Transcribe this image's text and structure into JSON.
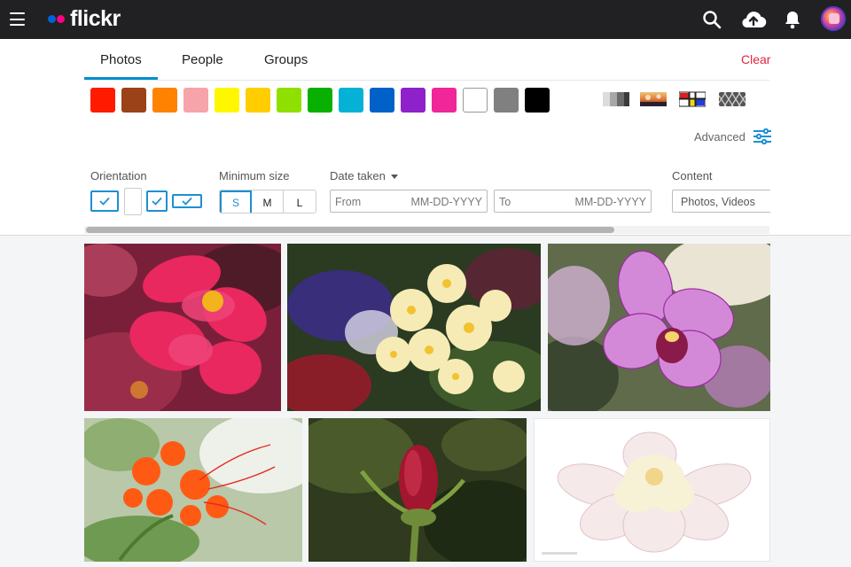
{
  "app": {
    "name": "flickr"
  },
  "tabs": [
    {
      "label": "Photos",
      "active": true
    },
    {
      "label": "People",
      "active": false
    },
    {
      "label": "Groups",
      "active": false
    }
  ],
  "clear_label": "Clear",
  "colors": [
    "#ff1a00",
    "#9c4218",
    "#ff8200",
    "#f7a3aa",
    "#fff700",
    "#ffcd00",
    "#8fe000",
    "#09b000",
    "#05b2d6",
    "#0062c9",
    "#8e21c9",
    "#f02799",
    "#ffffff",
    "#808080",
    "#000000"
  ],
  "style_filters": [
    "black-and-white-icon",
    "shallow-depth-of-field-icon",
    "minimalist-icon",
    "pattern-icon"
  ],
  "advanced_label": "Advanced",
  "filters": {
    "orientation": {
      "label": "Orientation",
      "options": [
        {
          "name": "landscape",
          "checked": true
        },
        {
          "name": "portrait",
          "checked": false
        },
        {
          "name": "square",
          "checked": true
        },
        {
          "name": "panorama",
          "checked": true
        }
      ]
    },
    "min_size": {
      "label": "Minimum size",
      "options": [
        "S",
        "M",
        "L"
      ],
      "selected": "S"
    },
    "date_taken": {
      "label": "Date taken",
      "from_label": "From",
      "to_label": "To",
      "placeholder": "MM-DD-YYYY"
    },
    "content": {
      "label": "Content",
      "value": "Photos, Videos"
    }
  },
  "photos": [
    {
      "name": "photo-pink-begonia"
    },
    {
      "name": "photo-cream-primroses"
    },
    {
      "name": "photo-purple-orchid"
    },
    {
      "name": "photo-orange-flowers"
    },
    {
      "name": "photo-red-rosebud"
    },
    {
      "name": "photo-white-peony"
    }
  ]
}
